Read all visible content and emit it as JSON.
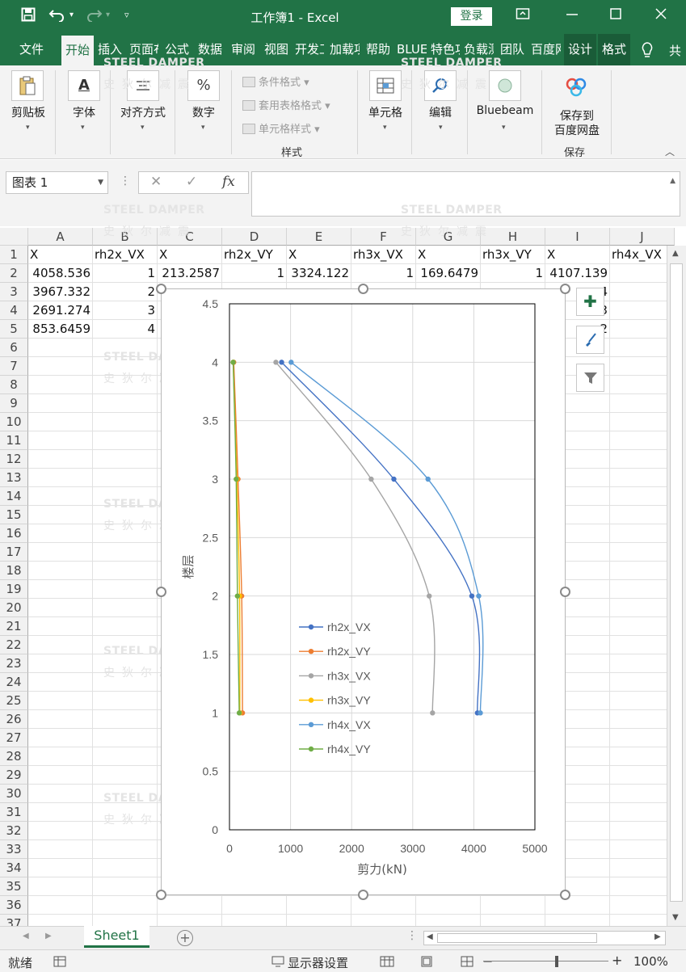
{
  "titlebar": {
    "document_title": "工作簿1  -  Excel",
    "login_label": "登录",
    "save_icon": "save-icon",
    "undo_icon": "undo-icon",
    "redo_icon": "redo-icon"
  },
  "tabs": [
    "文件",
    "开始",
    "插入",
    "页面布局",
    "公式",
    "数据",
    "审阅",
    "视图",
    "开发工具",
    "加载项",
    "帮助",
    "BLUEBEAM",
    "特色功能",
    "负载测试",
    "团队",
    "百度网盘",
    "设计",
    "格式"
  ],
  "active_tab": "开始",
  "ribbon": {
    "clipboard": "剪贴板",
    "font": "字体",
    "alignment": "对齐方式",
    "number": "数字",
    "conditional_format": "条件格式",
    "table_format": "套用表格格式",
    "cell_styles": "单元格样式",
    "styles_group": "样式",
    "cells": "单元格",
    "editing": "编辑",
    "bluebeam": "Bluebeam",
    "save_to_label_1": "保存到",
    "save_to_label_2": "百度网盘",
    "save_group": "保存"
  },
  "formula_bar": {
    "name_box": "图表 1",
    "cancel": "✕",
    "enter": "✓",
    "fx": "fx",
    "formula": ""
  },
  "sheet": {
    "columns": [
      "A",
      "B",
      "C",
      "D",
      "E",
      "F",
      "G",
      "H",
      "I",
      "J"
    ],
    "rows": [
      "1",
      "2",
      "3",
      "4",
      "5",
      "6",
      "7",
      "8",
      "9",
      "10",
      "11",
      "12",
      "13",
      "14",
      "15",
      "16",
      "17",
      "18",
      "19",
      "20",
      "21",
      "22",
      "23",
      "24",
      "25",
      "26",
      "27",
      "28",
      "29",
      "30",
      "31",
      "32",
      "33",
      "34",
      "35",
      "36",
      "37"
    ],
    "header_row": [
      "X",
      "rh2x_VX",
      "X",
      "rh2x_VY",
      "X",
      "rh3x_VX",
      "X",
      "rh3x_VY",
      "X",
      "rh4x_VX"
    ],
    "data": [
      [
        "4058.536",
        "1",
        "213.2587",
        "1",
        "3324.122",
        "1",
        "169.6479",
        "1",
        "4107.139"
      ],
      [
        "3967.332",
        "2",
        "",
        "",
        "",
        "",
        "",
        "",
        ""
      ],
      [
        "2691.274",
        "3",
        "",
        "",
        "",
        "",
        "",
        "",
        ""
      ],
      [
        "853.6459",
        "4",
        "",
        "",
        "",
        "",
        "",
        "",
        ""
      ]
    ],
    "peeking_right_col": [
      "",
      "4",
      "3",
      "2"
    ],
    "sheet_tab": "Sheet1"
  },
  "watermark": {
    "line1": "STEEL DAMPER",
    "line2": "史狄尔减震"
  },
  "status": {
    "ready": "就绪",
    "display_settings": "显示器设置",
    "zoom_level": "100%"
  },
  "chart_data": {
    "type": "scatter",
    "title": "",
    "xlabel": "剪力(kN)",
    "ylabel": "楼层",
    "xlim": [
      0,
      5000
    ],
    "ylim": [
      0,
      4.5
    ],
    "xticks": [
      0,
      1000,
      2000,
      3000,
      4000,
      5000
    ],
    "yticks": [
      0,
      0.5,
      1,
      1.5,
      2,
      2.5,
      3,
      3.5,
      4,
      4.5
    ],
    "grid": true,
    "legend": "inside-left-bottom",
    "smooth_lines": true,
    "series": [
      {
        "name": "rh2x_VX",
        "color": "#4472c4",
        "x": [
          4058.536,
          3967.332,
          2691.274,
          853.6459
        ],
        "y": [
          1,
          2,
          3,
          4
        ]
      },
      {
        "name": "rh2x_VY",
        "color": "#ed7d31",
        "x": [
          213.2587,
          200,
          140,
          70
        ],
        "y": [
          1,
          2,
          3,
          4
        ]
      },
      {
        "name": "rh3x_VX",
        "color": "#a5a5a5",
        "x": [
          3324.122,
          3270,
          2320,
          760
        ],
        "y": [
          1,
          2,
          3,
          4
        ]
      },
      {
        "name": "rh3x_VY",
        "color": "#ffc000",
        "x": [
          169.6479,
          165,
          120,
          60
        ],
        "y": [
          1,
          2,
          3,
          4
        ]
      },
      {
        "name": "rh4x_VX",
        "color": "#5b9bd5",
        "x": [
          4107.139,
          4080,
          3250,
          1010
        ],
        "y": [
          1,
          2,
          3,
          4
        ]
      },
      {
        "name": "rh4x_VY",
        "color": "#70ad47",
        "x": [
          160,
          130,
          110,
          60
        ],
        "y": [
          1,
          2,
          3,
          4
        ]
      }
    ]
  }
}
